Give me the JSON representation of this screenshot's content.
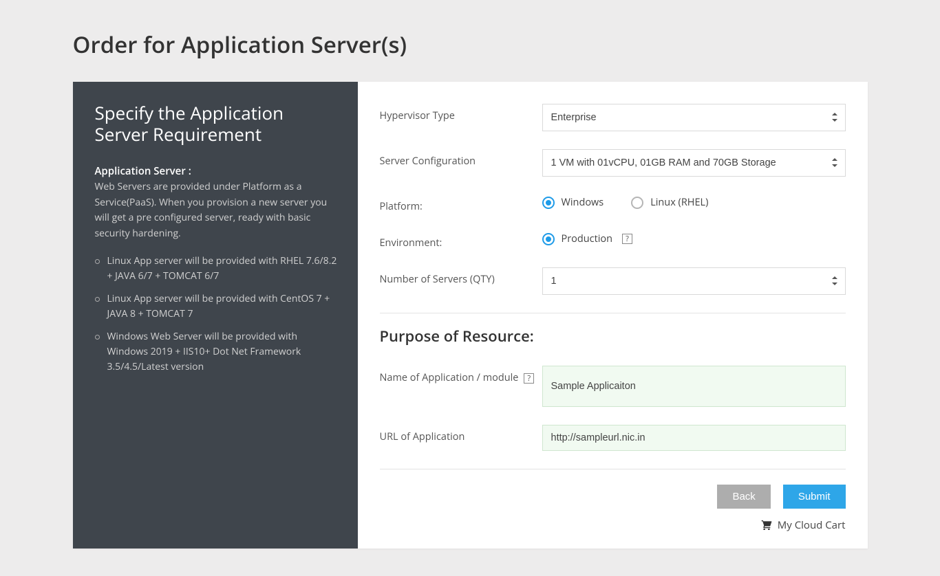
{
  "page": {
    "title": "Order for Application Server(s)"
  },
  "sidebar": {
    "heading": "Specify the Application Server Requirement",
    "subhead": "Application Server :",
    "description": "Web Servers are provided under Platform as a Service(PaaS). When you provision a new server you will get a pre configured server, ready with basic security hardening.",
    "bullets": [
      "Linux App server will be provided with RHEL 7.6/8.2 + JAVA 6/7 + TOMCAT 6/7",
      "Linux App server will be provided with CentOS 7 + JAVA 8 + TOMCAT 7",
      "Windows Web Server will be provided with Windows 2019 + IIS10+ Dot Net Framework 3.5/4.5/Latest version"
    ]
  },
  "form": {
    "hypervisor": {
      "label": "Hypervisor Type",
      "value": "Enterprise"
    },
    "server_config": {
      "label": "Server Configuration",
      "value": "1 VM with 01vCPU, 01GB RAM and 70GB Storage"
    },
    "platform": {
      "label": "Platform:",
      "options": [
        "Windows",
        "Linux (RHEL)"
      ],
      "selected": "Windows"
    },
    "environment": {
      "label": "Environment:",
      "option": "Production",
      "selected": true
    },
    "qty": {
      "label": "Number of Servers (QTY)",
      "value": "1"
    },
    "purpose_heading": "Purpose of Resource:",
    "app_name": {
      "label": "Name of Application / module",
      "value": "Sample Applicaiton"
    },
    "app_url": {
      "label": "URL of Application",
      "value": "http://sampleurl.nic.in"
    }
  },
  "buttons": {
    "back": "Back",
    "submit": "Submit"
  },
  "cart": {
    "label": "My Cloud Cart"
  }
}
